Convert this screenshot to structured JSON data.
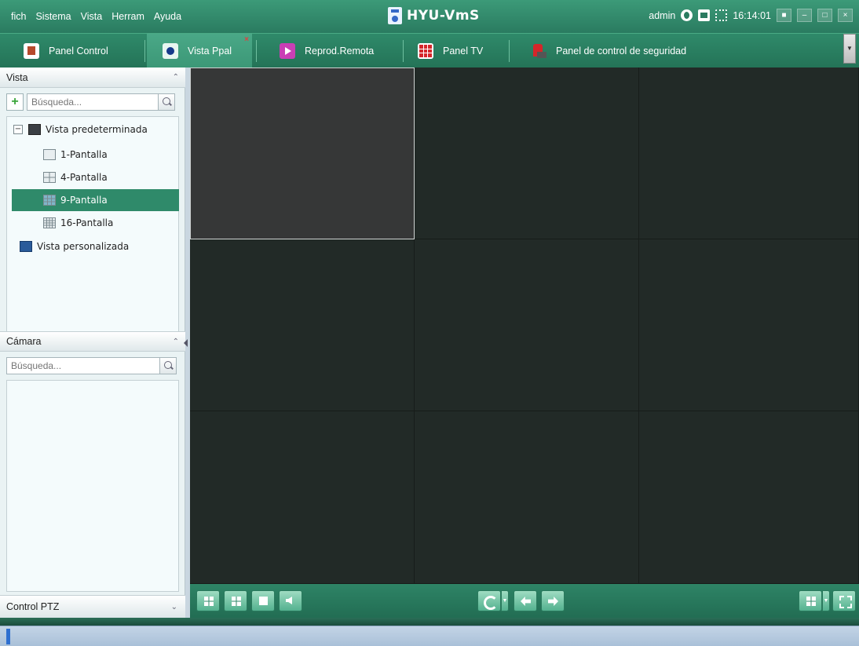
{
  "titlebar": {
    "menu": [
      "fich",
      "Sistema",
      "Vista",
      "Herram",
      "Ayuda"
    ],
    "app_name": "HYU-VmS",
    "user": "admin",
    "time": "16:14:01",
    "minimize": "–",
    "maximize": "□",
    "close": "×"
  },
  "tabs": [
    {
      "label": "Panel Control",
      "icon": "home-icon"
    },
    {
      "label": "Vista Ppal",
      "icon": "live-view-icon",
      "active": true,
      "closable": "×"
    },
    {
      "label": "Reprod.Remota",
      "icon": "playback-icon"
    },
    {
      "label": "Panel TV",
      "icon": "tv-wall-icon"
    },
    {
      "label": "Panel de control de seguridad",
      "icon": "alarm-icon"
    }
  ],
  "sidebar": {
    "view_section": {
      "title": "Vista",
      "search_placeholder": "Búsqueda...",
      "tree": {
        "root": "Vista predeterminada",
        "root_toggle": "−",
        "items": [
          "1-Pantalla",
          "4-Pantalla",
          "9-Pantalla",
          "16-Pantalla"
        ],
        "selected": "9-Pantalla",
        "custom": "Vista personalizada"
      }
    },
    "camera_section": {
      "title": "Cámara",
      "search_placeholder": "Búsqueda..."
    },
    "ptz_section": {
      "title": "Control PTZ"
    }
  },
  "video_grid": {
    "rows": 3,
    "cols": 3,
    "selected_cell": 1
  },
  "colors": {
    "accent": "#2f8a6a",
    "video_bg": "#222a27",
    "selected_cell": "#363737"
  }
}
